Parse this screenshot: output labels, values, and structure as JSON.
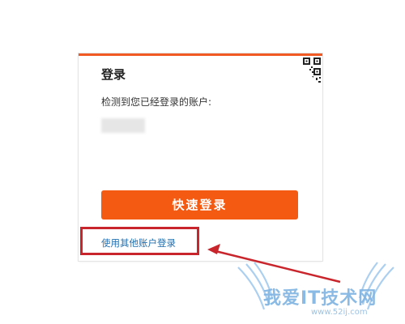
{
  "login": {
    "title": "登录",
    "detected_text": "检测到您已经登录的账户:",
    "quick_login_button": "快速登录",
    "other_account_link": "使用其他账户登录",
    "qr_icon": "qr-code-icon"
  },
  "annotation": {
    "box_color": "#c9252c",
    "arrow_color": "#c9252c"
  },
  "watermark": {
    "site": "我爱IT技术网",
    "domain": "www.52ij.com"
  },
  "colors": {
    "accent": "#f55a12",
    "link": "#1f6fb2"
  }
}
